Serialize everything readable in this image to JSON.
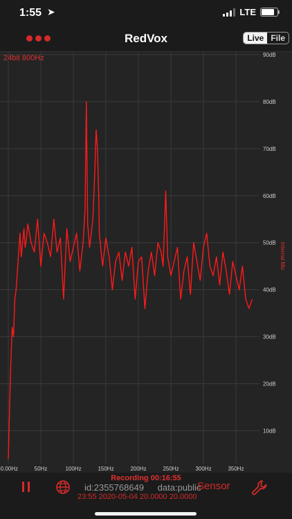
{
  "status_bar": {
    "time": "1:55",
    "location_icon": "location-arrow-icon",
    "network": "LTE",
    "signal_icon": "signal-bars-icon",
    "battery_icon": "battery-icon"
  },
  "nav": {
    "menu_icon": "three-dots-menu-icon",
    "title": "RedVox",
    "segments": [
      "Live",
      "File"
    ],
    "selected_segment": "Live"
  },
  "chart_data": {
    "type": "line",
    "title": "",
    "annotation": "24bit 800Hz",
    "xlabel": "",
    "ylabel": "Internal Mic",
    "x_tick_labels": [
      "-0.00Hz",
      "50Hz",
      "100Hz",
      "150Hz",
      "200Hz",
      "250Hz",
      "300Hz",
      "350Hz"
    ],
    "y_tick_labels": [
      "10dB",
      "20dB",
      "30dB",
      "40dB",
      "50dB",
      "60dB",
      "70dB",
      "80dB",
      "90dB"
    ],
    "xlim": [
      0,
      400
    ],
    "ylim": [
      3,
      90
    ],
    "grid": true,
    "line_color": "#ff1a1a",
    "series": [
      {
        "x": [
          0,
          2,
          4,
          6,
          8,
          10,
          12,
          14,
          16,
          18,
          20,
          22,
          24,
          26,
          28,
          30,
          35,
          40,
          45,
          50,
          55,
          60,
          65,
          70,
          75,
          80,
          85,
          90,
          95,
          100,
          105,
          110,
          115,
          118,
          120,
          122,
          125,
          130,
          133,
          135,
          137,
          139,
          140,
          142,
          145,
          150,
          155,
          160,
          165,
          170,
          175,
          180,
          185,
          190,
          195,
          200,
          205,
          210,
          215,
          220,
          225,
          230,
          235,
          238,
          240,
          242,
          245,
          250,
          255,
          260,
          265,
          270,
          275,
          280,
          285,
          290,
          295,
          300,
          305,
          310,
          315,
          320,
          325,
          330,
          335,
          340,
          345,
          350,
          355,
          360,
          365,
          370,
          375
        ],
        "values": [
          4,
          15,
          25,
          32,
          30,
          38,
          40,
          44,
          48,
          52,
          47,
          50,
          53,
          49,
          51,
          54,
          50,
          48,
          55,
          45,
          52,
          50,
          47,
          55,
          48,
          51,
          38,
          53,
          46,
          49,
          52,
          44,
          50,
          57,
          80,
          54,
          49,
          55,
          65,
          74,
          70,
          60,
          52,
          49,
          45,
          51,
          47,
          40,
          46,
          48,
          42,
          48,
          45,
          49,
          38,
          46,
          47,
          36,
          44,
          48,
          43,
          50,
          48,
          45,
          53,
          61,
          47,
          43,
          46,
          49,
          38,
          44,
          47,
          39,
          50,
          46,
          42,
          49,
          52,
          45,
          43,
          47,
          41,
          48,
          44,
          39,
          46,
          43,
          40,
          45,
          38,
          36,
          38
        ]
      }
    ]
  },
  "bottom_bar": {
    "pause_icon": "pause-icon",
    "globe_icon": "globe-icon",
    "wrench_icon": "wrench-icon",
    "recording_text": "Recording 00:16:55",
    "id_text": "id:2355768649",
    "data_text": "data:public",
    "sensor_label": "Sensor",
    "time_text": "23:55 2020-05-04 20.0000 20.0000"
  }
}
